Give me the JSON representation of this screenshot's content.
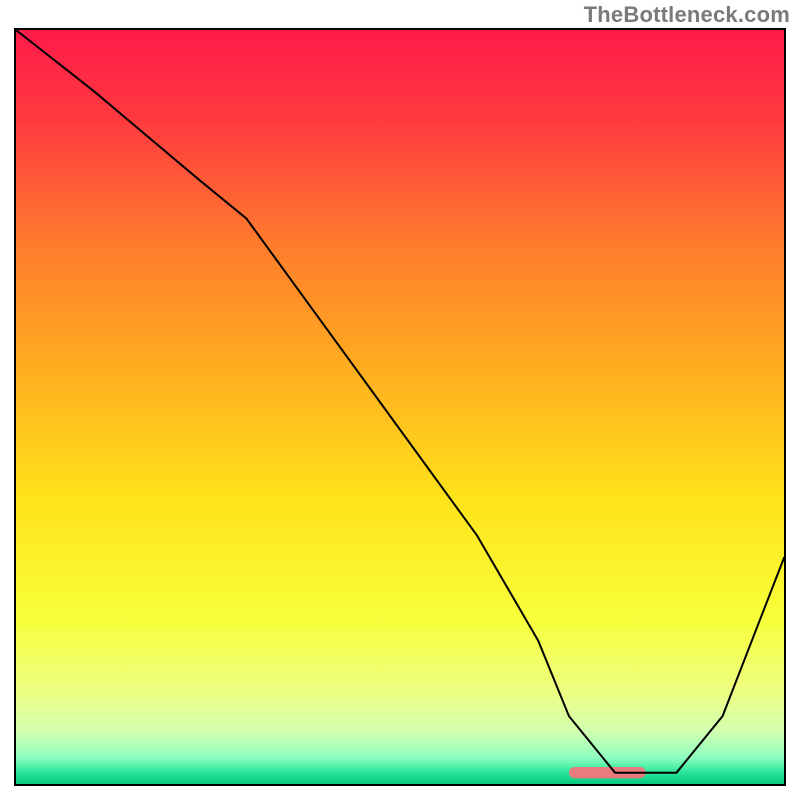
{
  "watermark": "TheBottleneck.com",
  "chart_data": {
    "type": "line",
    "title": "",
    "xlabel": "",
    "ylabel": "",
    "x_range": [
      0,
      100
    ],
    "y_range": [
      0,
      100
    ],
    "axes_visible": false,
    "grid": false,
    "background_gradient": {
      "stops": [
        {
          "offset": 0.0,
          "color": "#ff1b49"
        },
        {
          "offset": 0.12,
          "color": "#ff3a3f"
        },
        {
          "offset": 0.28,
          "color": "#ff7a2d"
        },
        {
          "offset": 0.45,
          "color": "#ffae20"
        },
        {
          "offset": 0.62,
          "color": "#ffe21a"
        },
        {
          "offset": 0.78,
          "color": "#f8ff3a"
        },
        {
          "offset": 0.88,
          "color": "#ecff84"
        },
        {
          "offset": 0.93,
          "color": "#d2ffb0"
        },
        {
          "offset": 0.965,
          "color": "#8fffc0"
        },
        {
          "offset": 0.985,
          "color": "#28e59a"
        },
        {
          "offset": 1.0,
          "color": "#04c77d"
        }
      ]
    },
    "series": [
      {
        "name": "curve",
        "color": "#000000",
        "stroke_width": 2.0,
        "x": [
          0,
          10,
          24,
          30,
          40,
          50,
          60,
          68,
          72,
          78,
          80,
          86,
          92,
          100
        ],
        "values": [
          100,
          92,
          80,
          75,
          61,
          47,
          33,
          19,
          9,
          1.5,
          1.5,
          1.5,
          9,
          30
        ]
      }
    ],
    "marker": {
      "name": "highlight-pill",
      "color": "#e77b7d",
      "x_start": 72,
      "x_end": 82,
      "y": 1.5,
      "height_ratio": 0.015
    },
    "border": {
      "color": "#000000",
      "width": 2
    }
  }
}
